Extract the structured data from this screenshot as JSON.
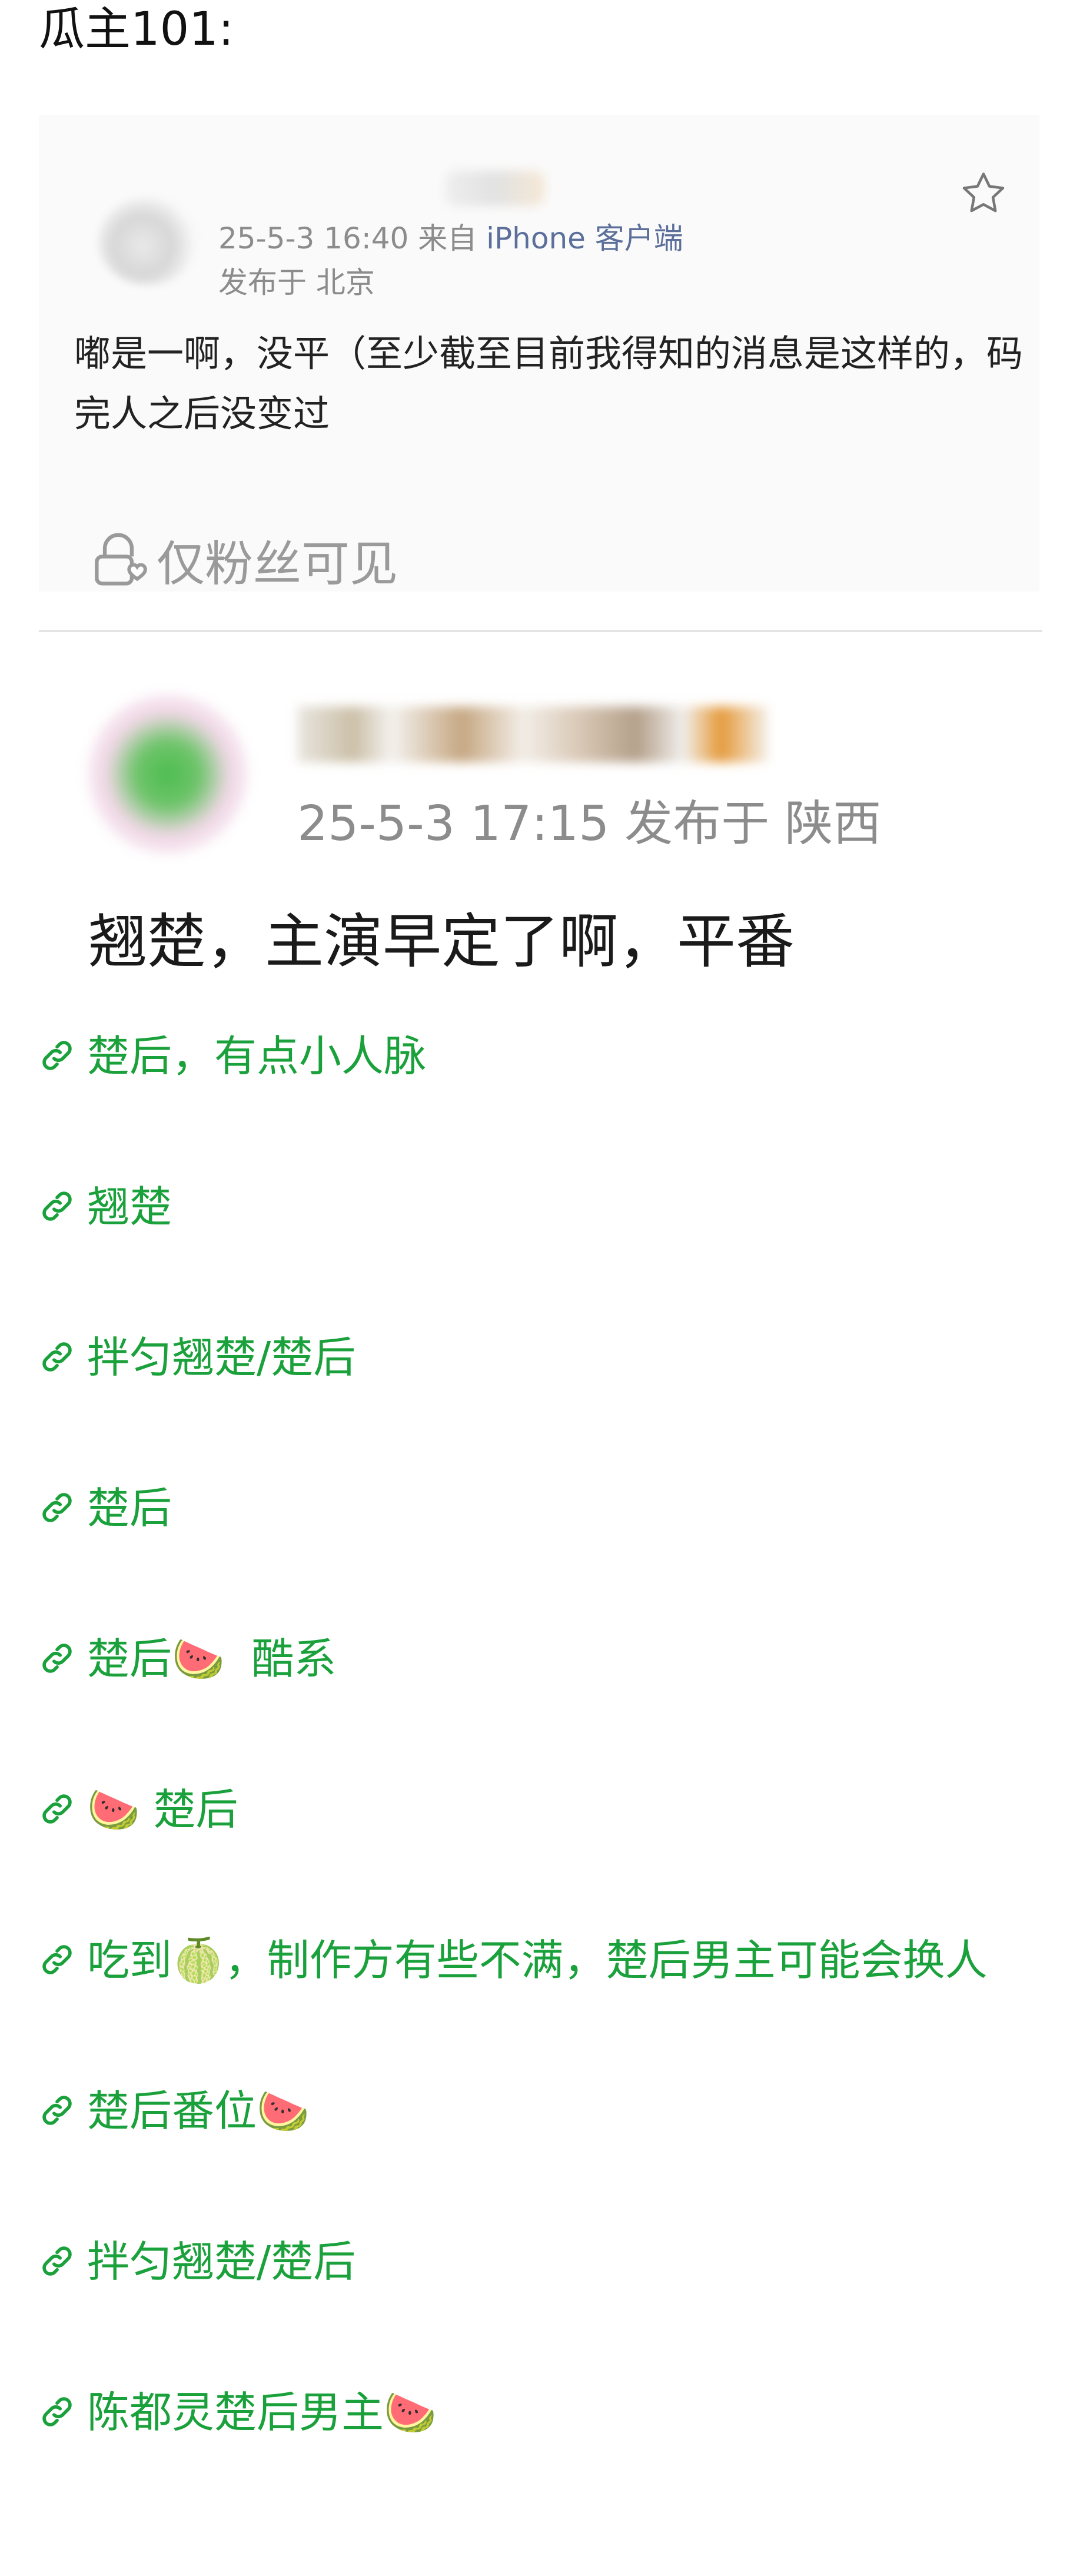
{
  "header": {
    "title": "瓜主101:"
  },
  "post1": {
    "timestamp": "25-5-3 16:40",
    "from_prefix": "来自",
    "client": "iPhone 客户端",
    "location": "发布于 北京",
    "text": "嘟是一啊，没平（至少截至目前我得知的消息是这样的，码完人之后没变过",
    "fans_only": "仅粉丝可见"
  },
  "post2": {
    "meta": "25-5-3 17:15  发布于 陕西",
    "text": "翘楚，主演早定了啊，平番"
  },
  "links": [
    "楚后，有点小人脉",
    "翘楚",
    "拌匀翘楚/楚后",
    "楚后",
    "楚后🍉  酷系",
    "🍉 楚后",
    "吃到🍈，制作方有些不满，楚后男主可能会换人",
    "楚后番位🍉",
    "拌匀翘楚/楚后",
    "陈都灵楚后男主🍉"
  ],
  "icons": {
    "link": "link-icon",
    "star": "star-icon",
    "lock": "lock-heart-icon"
  },
  "colors": {
    "link_green": "#1aa13b",
    "meta_gray": "#8c8c8c",
    "client_blue": "#5b6f9a"
  }
}
